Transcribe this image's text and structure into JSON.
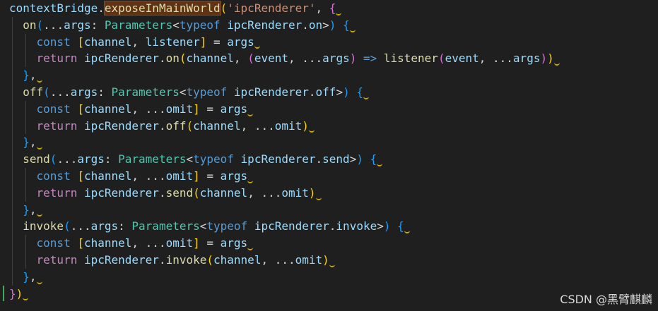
{
  "code": {
    "lines": [
      [
        {
          "t": "contextBridge",
          "c": "t-var"
        },
        {
          "t": ".",
          "c": "t-punc"
        },
        {
          "t": "exposeInMainWorld",
          "c": "t-fn highlight"
        },
        {
          "t": "(",
          "c": "t-br1"
        },
        {
          "t": "'ipcRenderer'",
          "c": "t-str"
        },
        {
          "t": ", ",
          "c": "t-punc"
        },
        {
          "t": "{",
          "c": "t-br2"
        }
      ],
      [
        {
          "t": "  on",
          "c": "t-fn"
        },
        {
          "t": "(",
          "c": "t-br3"
        },
        {
          "t": "...",
          "c": "t-punc"
        },
        {
          "t": "args",
          "c": "t-var"
        },
        {
          "t": ": ",
          "c": "t-punc"
        },
        {
          "t": "Parameters",
          "c": "t-type"
        },
        {
          "t": "<",
          "c": "t-punc"
        },
        {
          "t": "typeof",
          "c": "t-kw"
        },
        {
          "t": " ",
          "c": "t-punc"
        },
        {
          "t": "ipcRenderer",
          "c": "t-var"
        },
        {
          "t": ".",
          "c": "t-punc"
        },
        {
          "t": "on",
          "c": "t-var"
        },
        {
          "t": ">",
          "c": "t-punc"
        },
        {
          "t": ")",
          "c": "t-br3"
        },
        {
          "t": " ",
          "c": "t-punc"
        },
        {
          "t": "{",
          "c": "t-br3"
        }
      ],
      [
        {
          "t": "    const ",
          "c": "t-kw"
        },
        {
          "t": "[",
          "c": "t-br1"
        },
        {
          "t": "channel",
          "c": "t-var"
        },
        {
          "t": ", ",
          "c": "t-punc"
        },
        {
          "t": "listener",
          "c": "t-var"
        },
        {
          "t": "]",
          "c": "t-br1"
        },
        {
          "t": " = ",
          "c": "t-punc"
        },
        {
          "t": "args",
          "c": "t-var"
        }
      ],
      [
        {
          "t": "    return ",
          "c": "t-ctrl"
        },
        {
          "t": "ipcRenderer",
          "c": "t-var"
        },
        {
          "t": ".",
          "c": "t-punc"
        },
        {
          "t": "on",
          "c": "t-fn"
        },
        {
          "t": "(",
          "c": "t-br1"
        },
        {
          "t": "channel",
          "c": "t-var"
        },
        {
          "t": ", ",
          "c": "t-punc"
        },
        {
          "t": "(",
          "c": "t-br2"
        },
        {
          "t": "event",
          "c": "t-var"
        },
        {
          "t": ", ",
          "c": "t-punc"
        },
        {
          "t": "...",
          "c": "t-punc"
        },
        {
          "t": "args",
          "c": "t-var"
        },
        {
          "t": ")",
          "c": "t-br2"
        },
        {
          "t": " => ",
          "c": "t-kw"
        },
        {
          "t": "listener",
          "c": "t-fn"
        },
        {
          "t": "(",
          "c": "t-br2"
        },
        {
          "t": "event",
          "c": "t-var"
        },
        {
          "t": ", ",
          "c": "t-punc"
        },
        {
          "t": "...",
          "c": "t-punc"
        },
        {
          "t": "args",
          "c": "t-var"
        },
        {
          "t": ")",
          "c": "t-br2"
        },
        {
          "t": ")",
          "c": "t-br1"
        }
      ],
      [
        {
          "t": "  }",
          "c": "t-br3"
        },
        {
          "t": ",",
          "c": "t-punc"
        }
      ],
      [
        {
          "t": "  off",
          "c": "t-fn"
        },
        {
          "t": "(",
          "c": "t-br3"
        },
        {
          "t": "...",
          "c": "t-punc"
        },
        {
          "t": "args",
          "c": "t-var"
        },
        {
          "t": ": ",
          "c": "t-punc"
        },
        {
          "t": "Parameters",
          "c": "t-type"
        },
        {
          "t": "<",
          "c": "t-punc"
        },
        {
          "t": "typeof",
          "c": "t-kw"
        },
        {
          "t": " ",
          "c": "t-punc"
        },
        {
          "t": "ipcRenderer",
          "c": "t-var"
        },
        {
          "t": ".",
          "c": "t-punc"
        },
        {
          "t": "off",
          "c": "t-var"
        },
        {
          "t": ">",
          "c": "t-punc"
        },
        {
          "t": ")",
          "c": "t-br3"
        },
        {
          "t": " ",
          "c": "t-punc"
        },
        {
          "t": "{",
          "c": "t-br3"
        }
      ],
      [
        {
          "t": "    const ",
          "c": "t-kw"
        },
        {
          "t": "[",
          "c": "t-br1"
        },
        {
          "t": "channel",
          "c": "t-var"
        },
        {
          "t": ", ",
          "c": "t-punc"
        },
        {
          "t": "...",
          "c": "t-punc"
        },
        {
          "t": "omit",
          "c": "t-var"
        },
        {
          "t": "]",
          "c": "t-br1"
        },
        {
          "t": " = ",
          "c": "t-punc"
        },
        {
          "t": "args",
          "c": "t-var"
        }
      ],
      [
        {
          "t": "    return ",
          "c": "t-ctrl"
        },
        {
          "t": "ipcRenderer",
          "c": "t-var"
        },
        {
          "t": ".",
          "c": "t-punc"
        },
        {
          "t": "off",
          "c": "t-fn"
        },
        {
          "t": "(",
          "c": "t-br1"
        },
        {
          "t": "channel",
          "c": "t-var"
        },
        {
          "t": ", ",
          "c": "t-punc"
        },
        {
          "t": "...",
          "c": "t-punc"
        },
        {
          "t": "omit",
          "c": "t-var"
        },
        {
          "t": ")",
          "c": "t-br1"
        }
      ],
      [
        {
          "t": "  }",
          "c": "t-br3"
        },
        {
          "t": ",",
          "c": "t-punc"
        }
      ],
      [
        {
          "t": "  send",
          "c": "t-fn"
        },
        {
          "t": "(",
          "c": "t-br3"
        },
        {
          "t": "...",
          "c": "t-punc"
        },
        {
          "t": "args",
          "c": "t-var"
        },
        {
          "t": ": ",
          "c": "t-punc"
        },
        {
          "t": "Parameters",
          "c": "t-type"
        },
        {
          "t": "<",
          "c": "t-punc"
        },
        {
          "t": "typeof",
          "c": "t-kw"
        },
        {
          "t": " ",
          "c": "t-punc"
        },
        {
          "t": "ipcRenderer",
          "c": "t-var"
        },
        {
          "t": ".",
          "c": "t-punc"
        },
        {
          "t": "send",
          "c": "t-var"
        },
        {
          "t": ">",
          "c": "t-punc"
        },
        {
          "t": ")",
          "c": "t-br3"
        },
        {
          "t": " ",
          "c": "t-punc"
        },
        {
          "t": "{",
          "c": "t-br3"
        }
      ],
      [
        {
          "t": "    const ",
          "c": "t-kw"
        },
        {
          "t": "[",
          "c": "t-br1"
        },
        {
          "t": "channel",
          "c": "t-var"
        },
        {
          "t": ", ",
          "c": "t-punc"
        },
        {
          "t": "...",
          "c": "t-punc"
        },
        {
          "t": "omit",
          "c": "t-var"
        },
        {
          "t": "]",
          "c": "t-br1"
        },
        {
          "t": " = ",
          "c": "t-punc"
        },
        {
          "t": "args",
          "c": "t-var"
        }
      ],
      [
        {
          "t": "    return ",
          "c": "t-ctrl"
        },
        {
          "t": "ipcRenderer",
          "c": "t-var"
        },
        {
          "t": ".",
          "c": "t-punc"
        },
        {
          "t": "send",
          "c": "t-fn"
        },
        {
          "t": "(",
          "c": "t-br1"
        },
        {
          "t": "channel",
          "c": "t-var"
        },
        {
          "t": ", ",
          "c": "t-punc"
        },
        {
          "t": "...",
          "c": "t-punc"
        },
        {
          "t": "omit",
          "c": "t-var"
        },
        {
          "t": ")",
          "c": "t-br1"
        }
      ],
      [
        {
          "t": "  }",
          "c": "t-br3"
        },
        {
          "t": ",",
          "c": "t-punc"
        }
      ],
      [
        {
          "t": "  invoke",
          "c": "t-fn"
        },
        {
          "t": "(",
          "c": "t-br3"
        },
        {
          "t": "...",
          "c": "t-punc"
        },
        {
          "t": "args",
          "c": "t-var"
        },
        {
          "t": ": ",
          "c": "t-punc"
        },
        {
          "t": "Parameters",
          "c": "t-type"
        },
        {
          "t": "<",
          "c": "t-punc"
        },
        {
          "t": "typeof",
          "c": "t-kw"
        },
        {
          "t": " ",
          "c": "t-punc"
        },
        {
          "t": "ipcRenderer",
          "c": "t-var"
        },
        {
          "t": ".",
          "c": "t-punc"
        },
        {
          "t": "invoke",
          "c": "t-var"
        },
        {
          "t": ">",
          "c": "t-punc"
        },
        {
          "t": ")",
          "c": "t-br3"
        },
        {
          "t": " ",
          "c": "t-punc"
        },
        {
          "t": "{",
          "c": "t-br3"
        }
      ],
      [
        {
          "t": "    const ",
          "c": "t-kw"
        },
        {
          "t": "[",
          "c": "t-br1"
        },
        {
          "t": "channel",
          "c": "t-var"
        },
        {
          "t": ", ",
          "c": "t-punc"
        },
        {
          "t": "...",
          "c": "t-punc"
        },
        {
          "t": "omit",
          "c": "t-var"
        },
        {
          "t": "]",
          "c": "t-br1"
        },
        {
          "t": " = ",
          "c": "t-punc"
        },
        {
          "t": "args",
          "c": "t-var"
        }
      ],
      [
        {
          "t": "    return ",
          "c": "t-ctrl"
        },
        {
          "t": "ipcRenderer",
          "c": "t-var"
        },
        {
          "t": ".",
          "c": "t-punc"
        },
        {
          "t": "invoke",
          "c": "t-fn"
        },
        {
          "t": "(",
          "c": "t-br1"
        },
        {
          "t": "channel",
          "c": "t-var"
        },
        {
          "t": ", ",
          "c": "t-punc"
        },
        {
          "t": "...",
          "c": "t-punc"
        },
        {
          "t": "omit",
          "c": "t-var"
        },
        {
          "t": ")",
          "c": "t-br1"
        }
      ],
      [
        {
          "t": "  }",
          "c": "t-br3"
        },
        {
          "t": ",",
          "c": "t-punc"
        }
      ],
      [
        {
          "t": "}",
          "c": "t-br2"
        },
        {
          "t": ")",
          "c": "t-br1"
        }
      ]
    ]
  },
  "watermark": "CSDN @黑臂麒麟",
  "colors": {
    "background": "#1f1f1f",
    "variable": "#9cdcfe",
    "function": "#dcdcaa",
    "keyword": "#569cd6",
    "control": "#c586c0",
    "type": "#4ec9b0",
    "string": "#ce9178",
    "bracket_gold": "#ffd700",
    "bracket_orchid": "#da70d6",
    "bracket_blue": "#179fff",
    "squiggle": "#cca700",
    "selection_highlight": "#613214",
    "gutter_modified": "#3fa65a"
  }
}
